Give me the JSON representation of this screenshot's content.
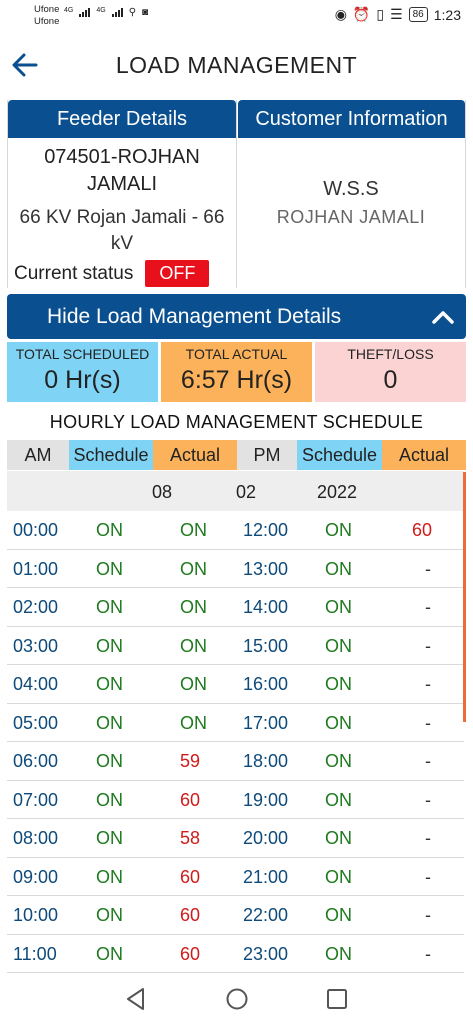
{
  "status_bar": {
    "carrier1": "Ufone",
    "carrier2": "Ufone",
    "net1": "4G",
    "net2": "4G",
    "battery": "86",
    "time": "1:23"
  },
  "header": {
    "title": "LOAD MANAGEMENT"
  },
  "feeder": {
    "heading": "Feeder Details",
    "code": "074501-ROJHAN JAMALI",
    "name": "66 KV Rojan Jamali - 66 kV",
    "status_label": "Current status",
    "status_value": "OFF"
  },
  "customer": {
    "heading": "Customer Information",
    "name": "W.S.S",
    "location": "ROJHAN JAMALI"
  },
  "toggle": {
    "label": "Hide Load Management Details"
  },
  "totals": {
    "scheduled_label": "TOTAL SCHEDULED",
    "scheduled_value": "0 Hr(s)",
    "actual_label": "TOTAL ACTUAL",
    "actual_value": "6:57 Hr(s)",
    "theft_label": "THEFT/LOSS",
    "theft_value": "0"
  },
  "schedule": {
    "title": "HOURLY LOAD MANAGEMENT SCHEDULE",
    "headers": [
      "AM",
      "Schedule",
      "Actual",
      "PM",
      "Schedule",
      "Actual"
    ],
    "date": {
      "month": "08",
      "day": "02",
      "year": "2022"
    },
    "rows": [
      {
        "am": "00:00",
        "am_sched": "ON",
        "am_actual": "ON",
        "pm": "12:00",
        "pm_sched": "ON",
        "pm_actual": "60"
      },
      {
        "am": "01:00",
        "am_sched": "ON",
        "am_actual": "ON",
        "pm": "13:00",
        "pm_sched": "ON",
        "pm_actual": "-"
      },
      {
        "am": "02:00",
        "am_sched": "ON",
        "am_actual": "ON",
        "pm": "14:00",
        "pm_sched": "ON",
        "pm_actual": "-"
      },
      {
        "am": "03:00",
        "am_sched": "ON",
        "am_actual": "ON",
        "pm": "15:00",
        "pm_sched": "ON",
        "pm_actual": "-"
      },
      {
        "am": "04:00",
        "am_sched": "ON",
        "am_actual": "ON",
        "pm": "16:00",
        "pm_sched": "ON",
        "pm_actual": "-"
      },
      {
        "am": "05:00",
        "am_sched": "ON",
        "am_actual": "ON",
        "pm": "17:00",
        "pm_sched": "ON",
        "pm_actual": "-"
      },
      {
        "am": "06:00",
        "am_sched": "ON",
        "am_actual": "59",
        "pm": "18:00",
        "pm_sched": "ON",
        "pm_actual": "-"
      },
      {
        "am": "07:00",
        "am_sched": "ON",
        "am_actual": "60",
        "pm": "19:00",
        "pm_sched": "ON",
        "pm_actual": "-"
      },
      {
        "am": "08:00",
        "am_sched": "ON",
        "am_actual": "58",
        "pm": "20:00",
        "pm_sched": "ON",
        "pm_actual": "-"
      },
      {
        "am": "09:00",
        "am_sched": "ON",
        "am_actual": "60",
        "pm": "21:00",
        "pm_sched": "ON",
        "pm_actual": "-"
      },
      {
        "am": "10:00",
        "am_sched": "ON",
        "am_actual": "60",
        "pm": "22:00",
        "pm_sched": "ON",
        "pm_actual": "-"
      },
      {
        "am": "11:00",
        "am_sched": "ON",
        "am_actual": "60",
        "pm": "23:00",
        "pm_sched": "ON",
        "pm_actual": "-"
      }
    ]
  },
  "colors": {
    "primary": "#0a4f8f",
    "scheduled_bg": "#7fd3f4",
    "actual_bg": "#fbb25a",
    "theft_bg": "#fbd3d3",
    "on_text": "#1e7a1e",
    "value_text": "#d01b1b",
    "off_badge": "#e8101b"
  },
  "icons": {
    "back": "arrow-left-icon",
    "collapse": "chevron-up-icon",
    "nav": [
      "back-triangle-icon",
      "home-circle-icon",
      "recents-square-icon"
    ]
  }
}
